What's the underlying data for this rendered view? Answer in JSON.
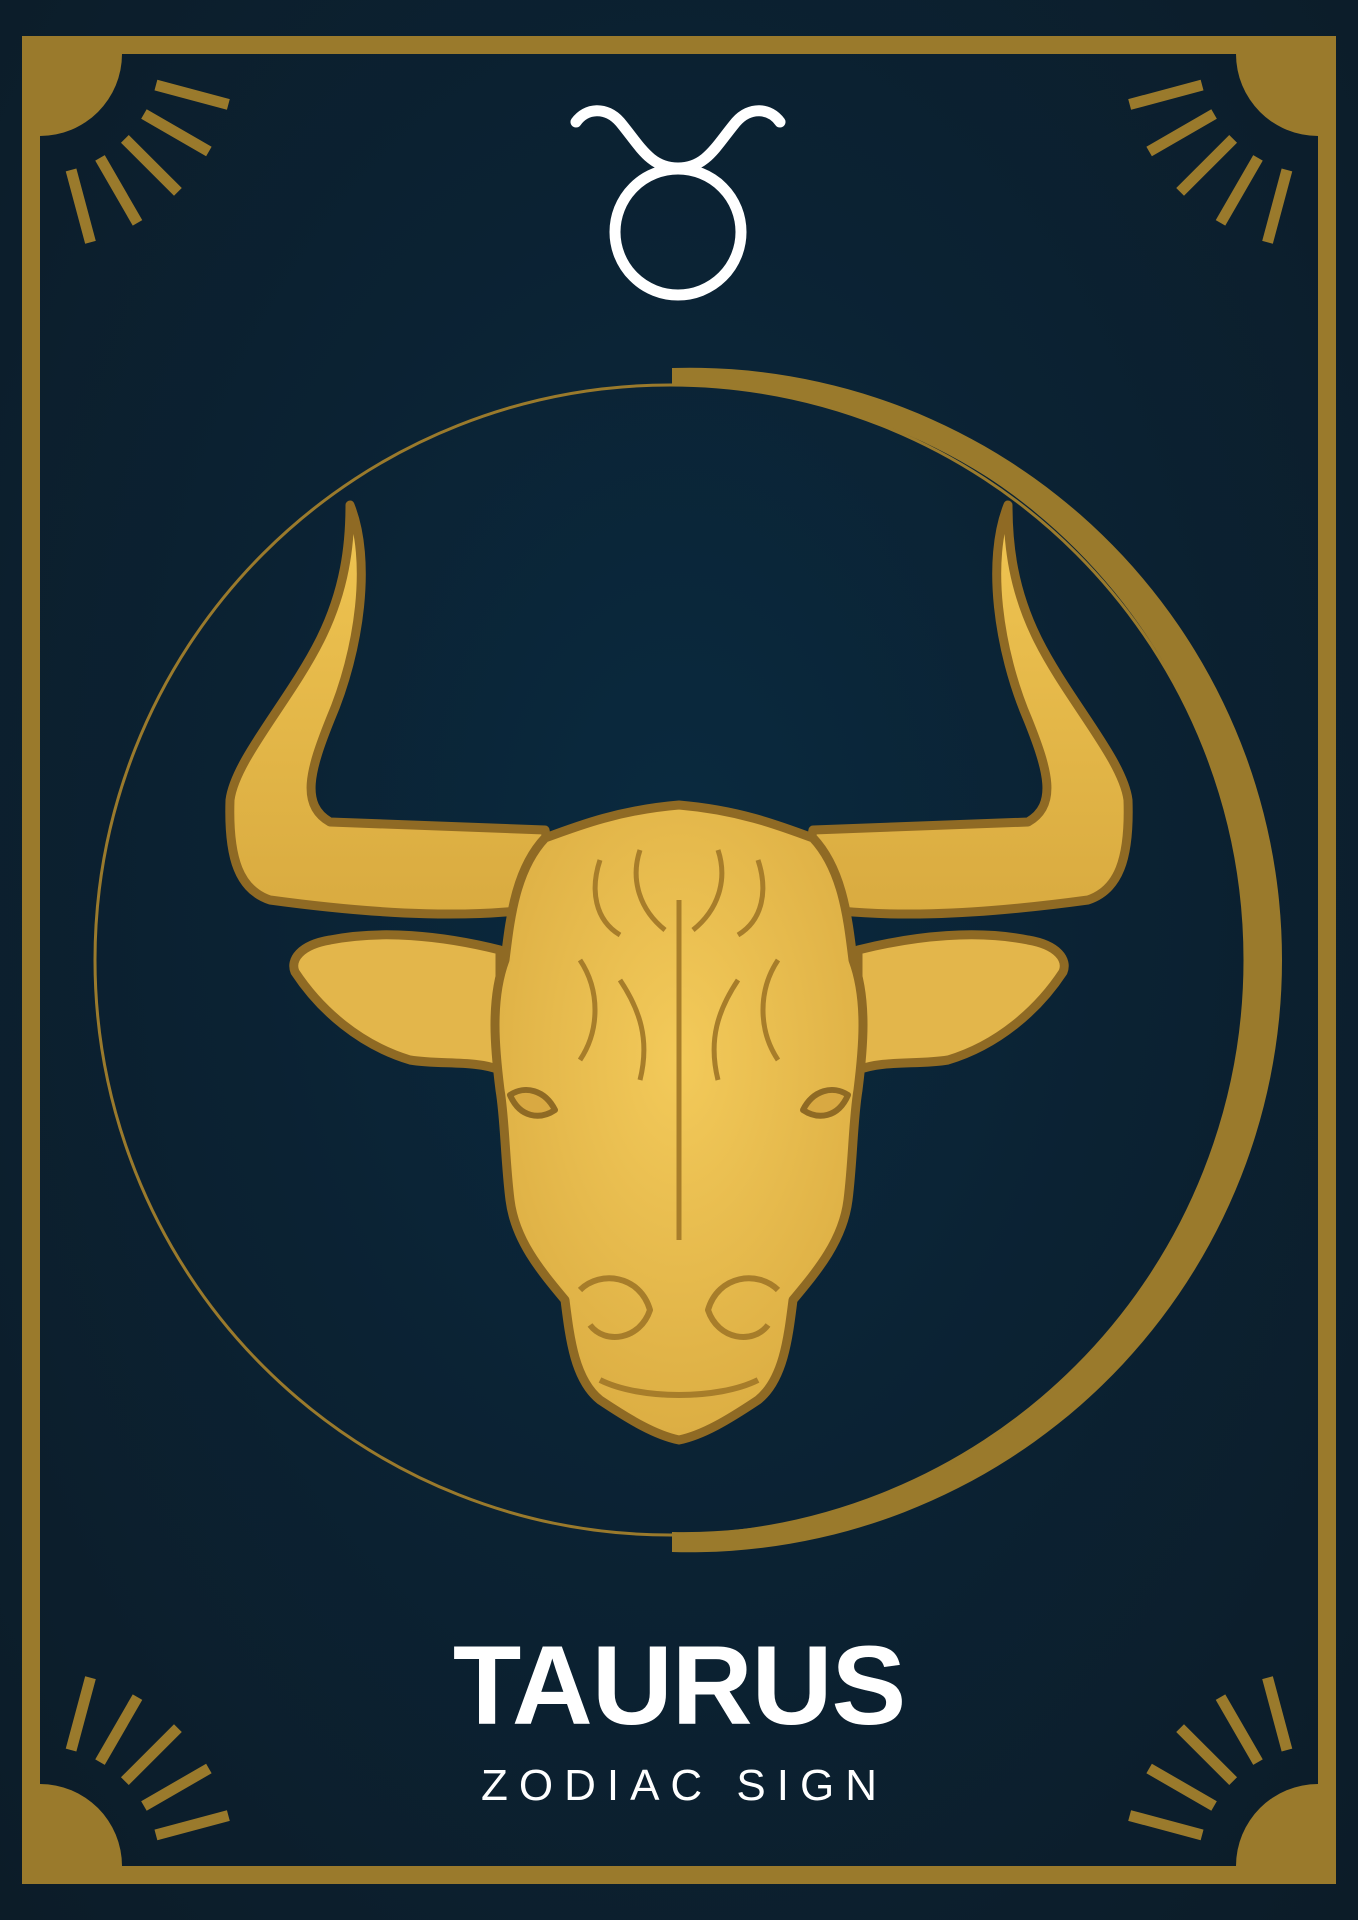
{
  "card": {
    "title": "TAURUS",
    "subtitle": "ZODIAC SIGN"
  },
  "colors": {
    "background": "#0c1e2a",
    "gold": "#9a7a2c",
    "bull_fill": "#e3b64b",
    "bull_light": "#f2c858",
    "text": "#ffffff"
  },
  "icons": [
    "taurus-glyph-icon",
    "bull-head-icon",
    "sunburst-corner-icon"
  ]
}
